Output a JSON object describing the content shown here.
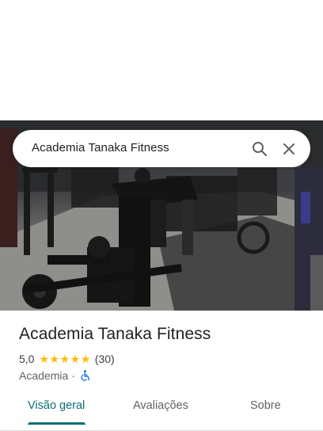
{
  "search": {
    "query": "Academia Tanaka Fitness",
    "search_icon": "search-icon",
    "close_icon": "close-icon"
  },
  "place": {
    "name": "Academia Tanaka Fitness",
    "rating": "5,0",
    "stars": 5,
    "reviews": "(30)",
    "category": "Academia",
    "separator": "·",
    "accessibility_icon": "wheelchair-accessible-icon"
  },
  "tabs": [
    {
      "label": "Visão geral",
      "active": true
    },
    {
      "label": "Avaliações",
      "active": false
    },
    {
      "label": "Sobre",
      "active": false
    }
  ],
  "colors": {
    "accent": "#0b6e74",
    "star": "#fbbc04",
    "accessibility": "#1a73e8"
  }
}
